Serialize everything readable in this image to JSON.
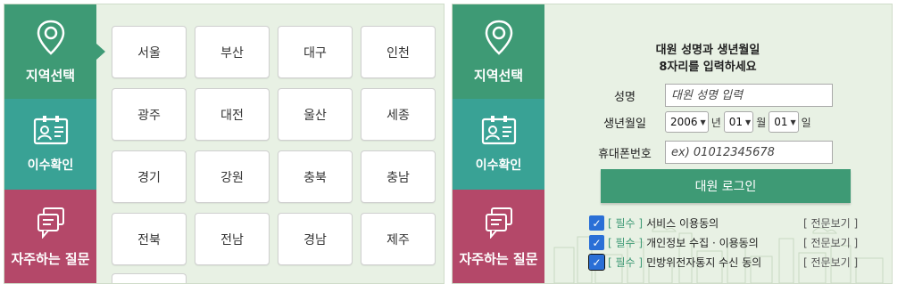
{
  "sidebar": {
    "items": [
      {
        "label": "지역선택",
        "icon": "map-pin-icon"
      },
      {
        "label": "이수확인",
        "icon": "id-card-icon"
      },
      {
        "label": "자주하는 질문",
        "icon": "chat-bubble-icon"
      }
    ]
  },
  "regions": [
    "서울",
    "부산",
    "대구",
    "인천",
    "광주",
    "대전",
    "울산",
    "세종",
    "경기",
    "강원",
    "충북",
    "충남",
    "전북",
    "전남",
    "경남",
    "제주"
  ],
  "login": {
    "title_line1": "대원 성명과 생년월일",
    "title_line2": "8자리를 입력하세요",
    "name_label": "성명",
    "name_placeholder": "대원 성명 입력",
    "birth_label": "생년월일",
    "year": "2006",
    "year_unit": "년",
    "month": "01",
    "month_unit": "월",
    "day": "01",
    "day_unit": "일",
    "phone_label": "휴대폰번호",
    "phone_placeholder": "ex) 01012345678",
    "button": "대원 로그인"
  },
  "agreements": [
    {
      "required": "[ 필수 ]",
      "text": "서비스 이용동의",
      "view": "[ 전문보기 ]"
    },
    {
      "required": "[ 필수 ]",
      "text": "개인정보 수집 · 이용동의",
      "view": "[ 전문보기 ]"
    },
    {
      "required": "[ 필수 ]",
      "text": "민방위전자통지 수신 동의",
      "view": "[ 전문보기 ]"
    }
  ],
  "colors": {
    "primary_green": "#3e9a75",
    "teal": "#39a295",
    "magenta": "#b44869",
    "panel_bg": "#e8f1e4",
    "checkbox_blue": "#2a6fd6"
  }
}
